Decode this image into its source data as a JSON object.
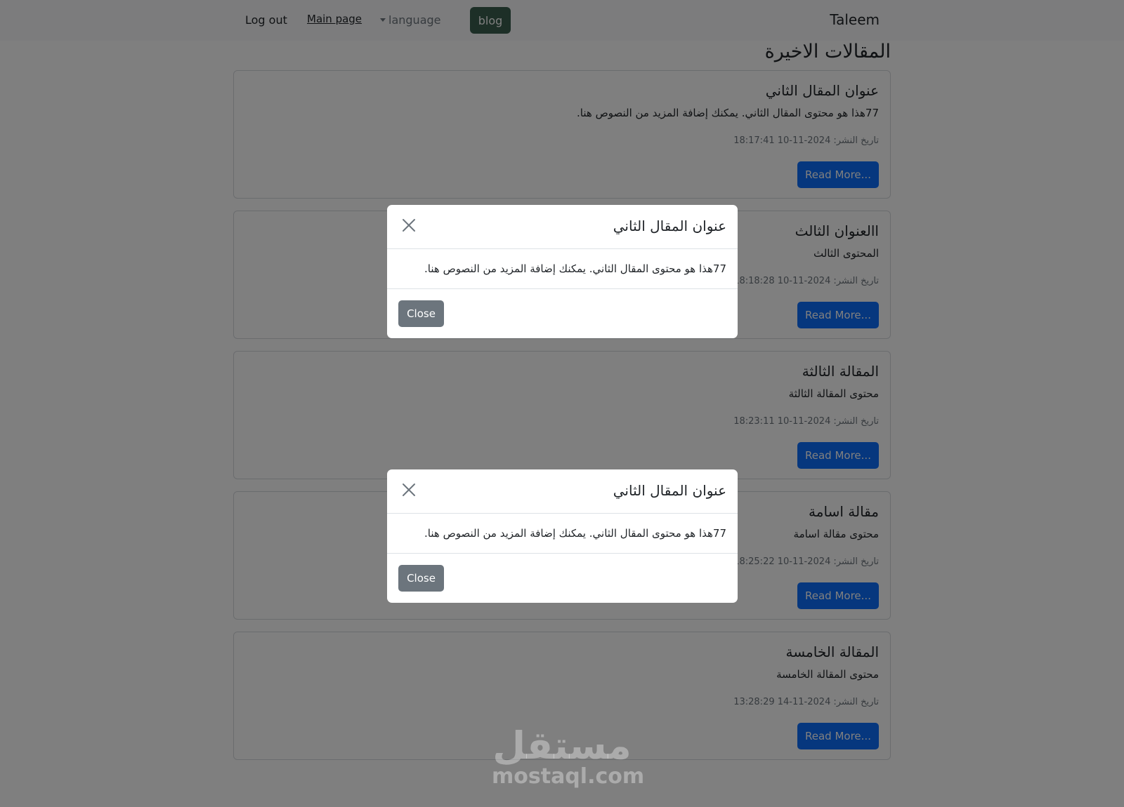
{
  "navbar": {
    "brand": "Taleem",
    "blog": "blog",
    "language": "language",
    "main_page": "Main page",
    "logout": "Log out"
  },
  "page_title": "المقالات الاخيرة",
  "articles": [
    {
      "title": "عنوان المقال الثاني",
      "content": "77هذا هو محتوى المقال الثاني. يمكنك إضافة المزيد من النصوص هنا.",
      "date_label": "تاريخ النشر:",
      "date": "2024-11-10 18:17:41",
      "read_more": "Read More..."
    },
    {
      "title": "االعنوان الثالث",
      "content": "المحتوى الثالث",
      "date_label": "تاريخ النشر:",
      "date": "2024-11-10 18:18:28",
      "read_more": "Read More..."
    },
    {
      "title": "المقالة الثالثة",
      "content": "محتوى المقالة الثالثة",
      "date_label": "تاريخ النشر:",
      "date": "2024-11-10 18:23:11",
      "read_more": "Read More..."
    },
    {
      "title": "مقالة اسامة",
      "content": "محتوى مقالة اسامة",
      "date_label": "تاريخ النشر:",
      "date": "2024-11-10 18:25:22",
      "read_more": "Read More..."
    },
    {
      "title": "المقالة الخامسة",
      "content": "محتوى المقالة الخامسة",
      "date_label": "تاريخ النشر:",
      "date": "2024-11-14 13:28:29",
      "read_more": "Read More..."
    }
  ],
  "modals": [
    {
      "title": "عنوان المقال الثاني",
      "body": "77هذا هو محتوى المقال الثاني. يمكنك إضافة المزيد من النصوص هنا.",
      "close": "Close",
      "close_icon": "close-icon"
    },
    {
      "title": "عنوان المقال الثاني",
      "body": "77هذا هو محتوى المقال الثاني. يمكنك إضافة المزيد من النصوص هنا.",
      "close": "Close",
      "close_icon": "close-icon"
    }
  ],
  "watermark": {
    "arabic": "مستقل",
    "latin": "mostaql.com"
  },
  "colors": {
    "primary": "#0d6efd",
    "secondary": "#6c757d",
    "blog_button": "#3b5e4f",
    "navbar_bg": "#f8f9fa",
    "backdrop": "rgba(0,0,0,0.5)"
  }
}
